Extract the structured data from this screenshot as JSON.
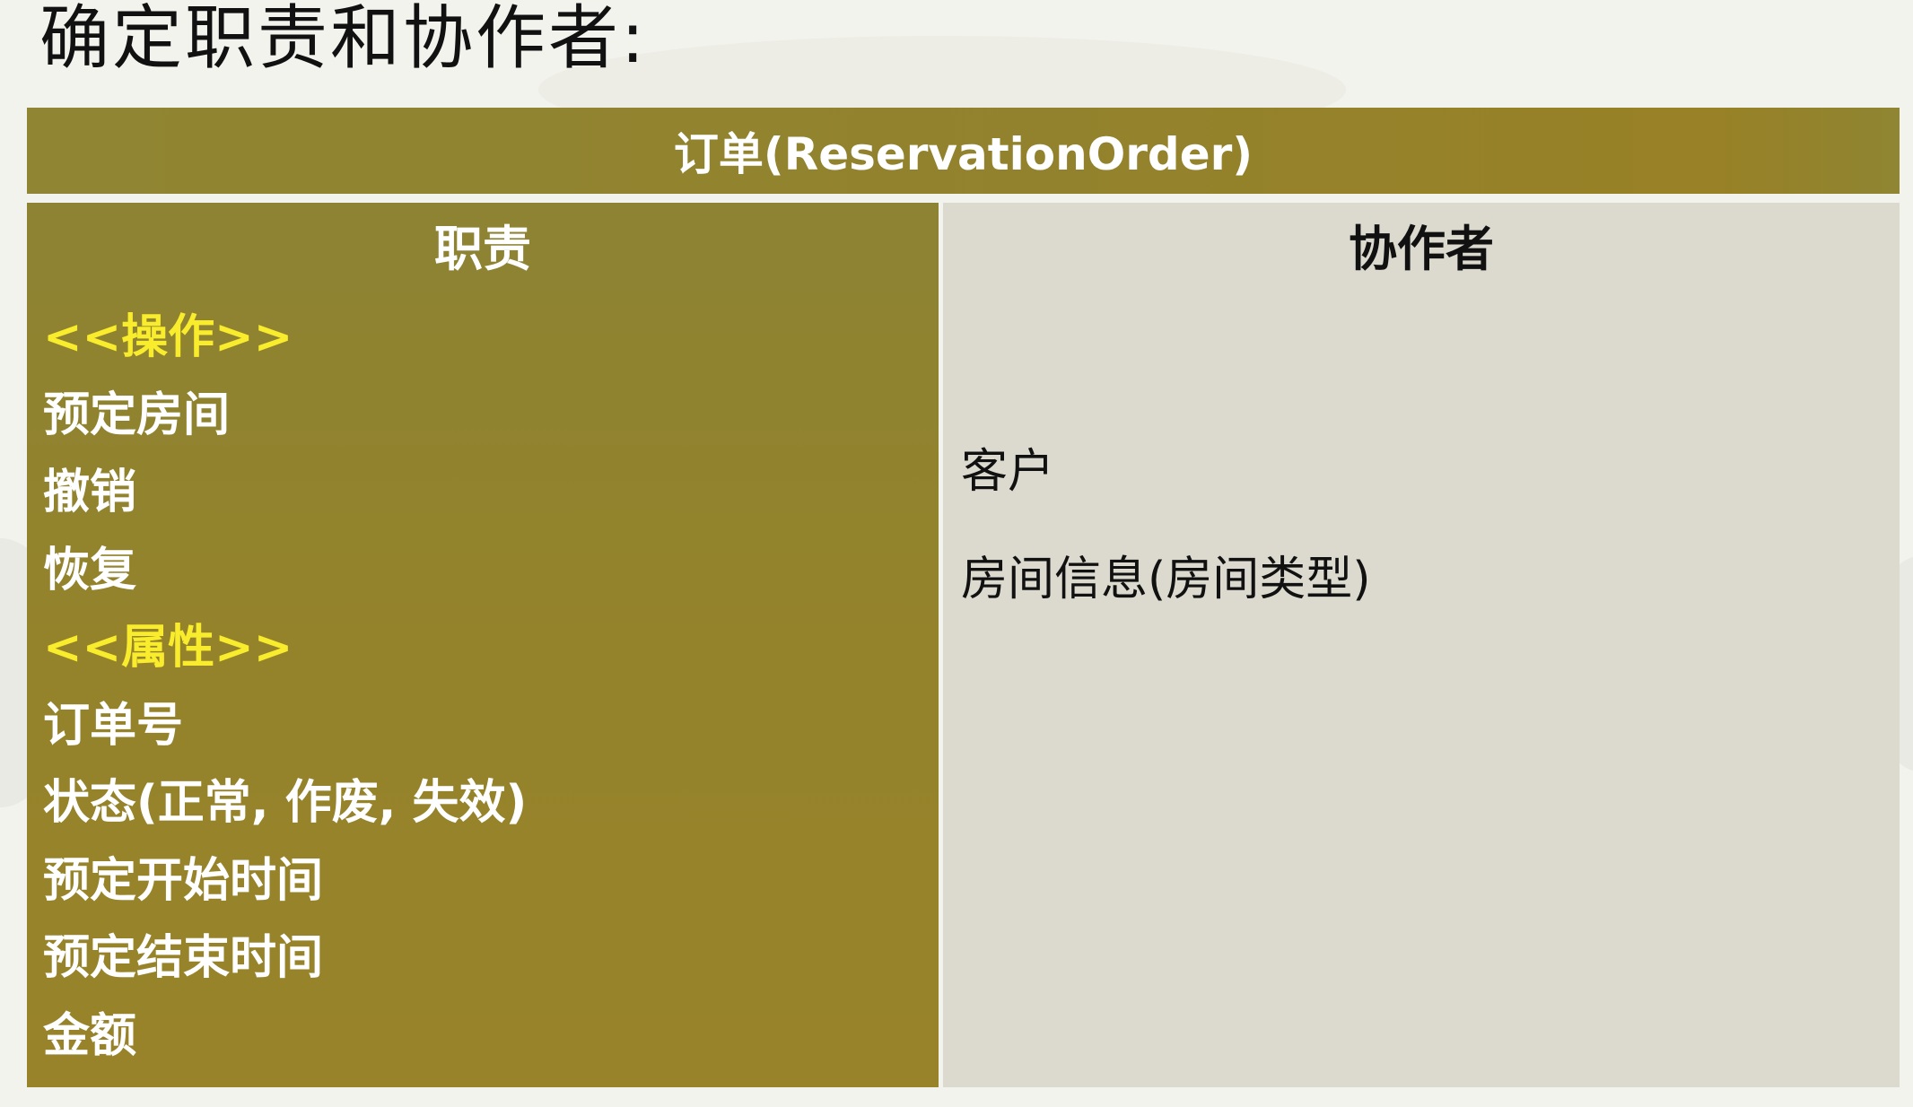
{
  "heading": "确定职责和协作者:",
  "card": {
    "title": "订单(ReservationOrder)",
    "responsibilities": {
      "header": "职责",
      "items": [
        {
          "text": "<<操作>>",
          "section": true
        },
        {
          "text": "预定房间",
          "section": false
        },
        {
          "text": "撤销",
          "section": false
        },
        {
          "text": "恢复",
          "section": false
        },
        {
          "text": "<<属性>>",
          "section": true
        },
        {
          "text": "订单号",
          "section": false
        },
        {
          "text": "状态(正常, 作废, 失效)",
          "section": false
        },
        {
          "text": "预定开始时间",
          "section": false
        },
        {
          "text": "预定结束时间",
          "section": false
        },
        {
          "text": "金额",
          "section": false
        }
      ]
    },
    "collaborators": {
      "header": "协作者",
      "items": [
        "客户",
        "房间信息(房间类型)"
      ]
    }
  },
  "colors": {
    "olive": "#93822d",
    "section_yellow": "#f8ec2d",
    "collab_bg": "#dcdace"
  }
}
